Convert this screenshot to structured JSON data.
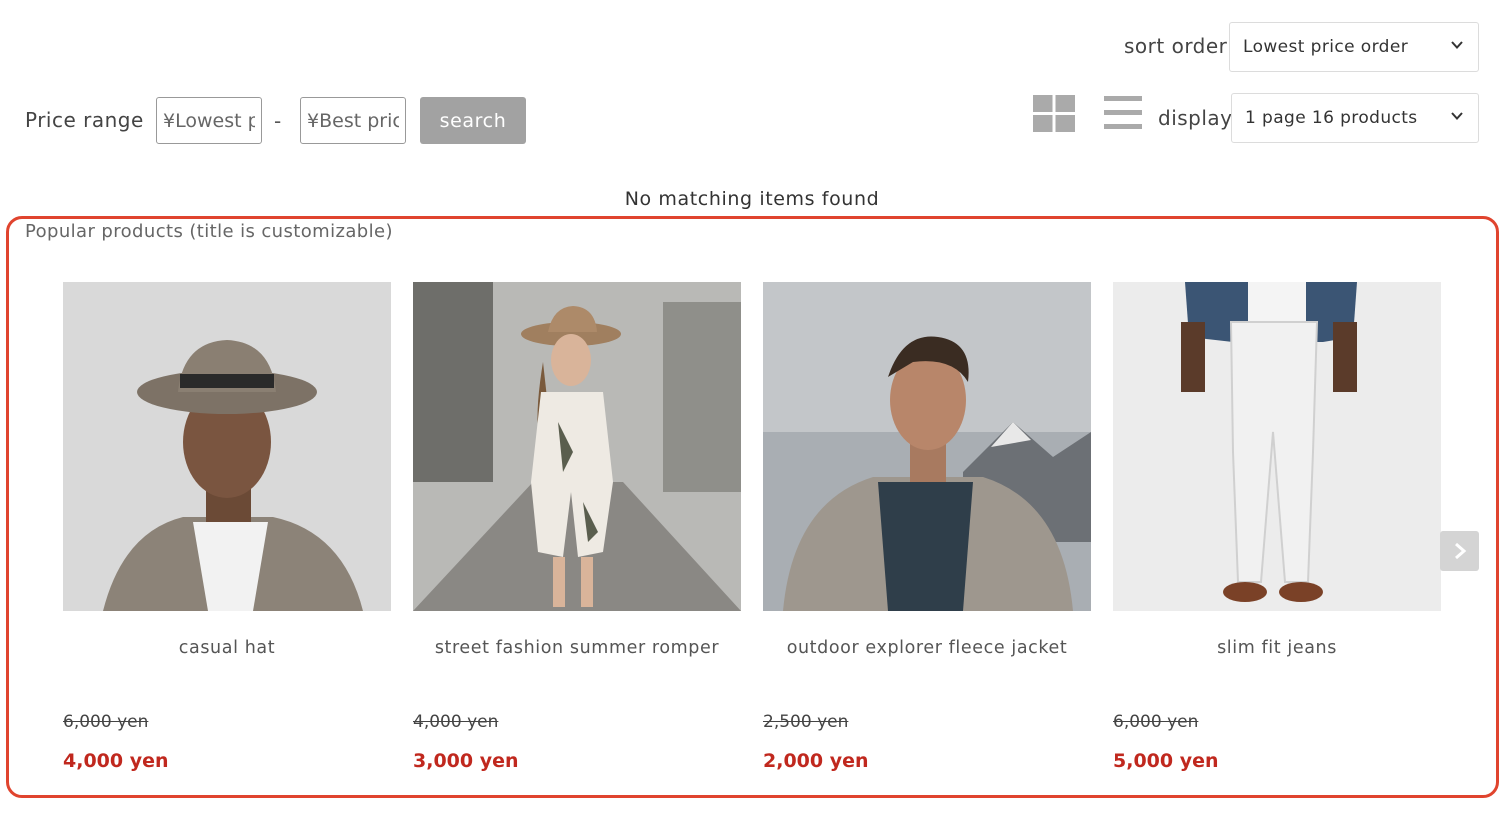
{
  "sort": {
    "label": "sort order",
    "selected": "Lowest price order"
  },
  "price": {
    "label": "Price range",
    "min_placeholder": "¥Lowest price",
    "max_placeholder": "¥Best price",
    "separator": "-",
    "search_label": "search"
  },
  "display": {
    "label": "display",
    "selected": "1 page 16 products"
  },
  "view_icons": [
    "grid-view-icon",
    "list-view-icon"
  ],
  "results": {
    "empty_message": "No matching items found"
  },
  "popular": {
    "title": "Popular products (title is customizable)",
    "border_color": "#e0442e",
    "items": [
      {
        "name": "casual hat",
        "old_price": "6,000 yen",
        "price": "4,000 yen"
      },
      {
        "name": "street fashion summer romper",
        "old_price": "4,000 yen",
        "price": "3,000 yen"
      },
      {
        "name": "outdoor explorer fleece jacket",
        "old_price": "2,500 yen",
        "price": "2,000 yen"
      },
      {
        "name": "slim fit jeans",
        "old_price": "6,000 yen",
        "price": "5,000 yen"
      }
    ]
  },
  "colors": {
    "sale_price": "#c0281e",
    "search_button": "#a2a2a2"
  }
}
